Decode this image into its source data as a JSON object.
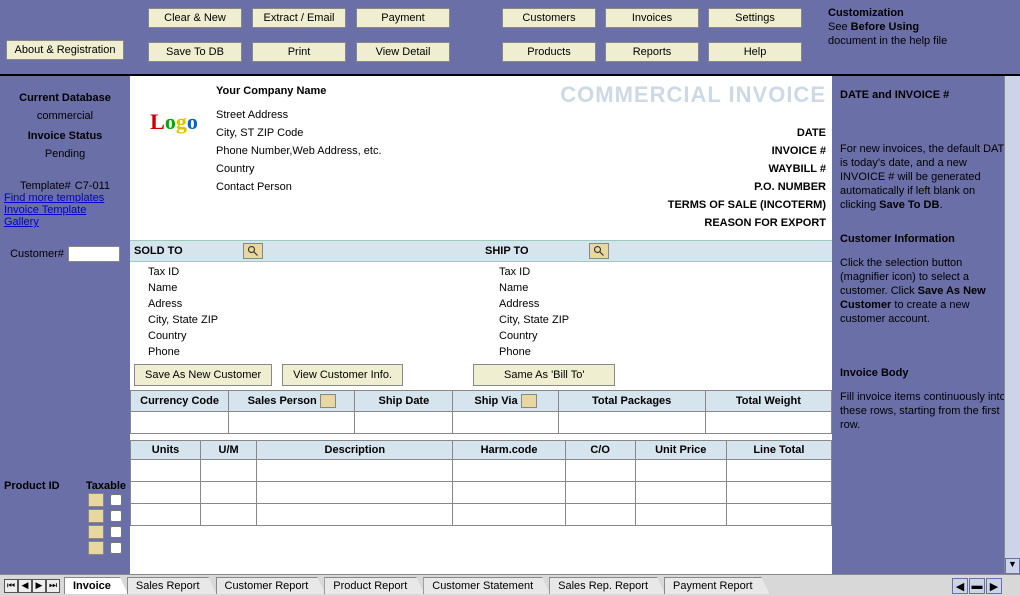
{
  "url": "www.office-kit.com",
  "buttons": {
    "about": "About & Registration",
    "clear_new": "Clear & New",
    "extract_email": "Extract / Email",
    "payment": "Payment",
    "customers": "Customers",
    "invoices": "Invoices",
    "settings": "Settings",
    "save_db": "Save To DB",
    "print": "Print",
    "view_detail": "View Detail",
    "products": "Products",
    "reports": "Reports",
    "help": "Help"
  },
  "top_help": {
    "title": "Customization",
    "l1": "See ",
    "b1": "Before Using",
    "l2": "document in the help file"
  },
  "left": {
    "db_hdr": "Current Database",
    "db_name": "commercial",
    "status_hdr": "Invoice Status",
    "status_val": "Pending",
    "template_lbl": "Template#",
    "template_val": "C7-011",
    "link1": "Find more templates",
    "link2": "Invoice Template ",
    "link3": "Gallery",
    "cust_lbl": "Customer#",
    "prod_hdr": "Product ID",
    "tax_hdr": "Taxable"
  },
  "center": {
    "company": {
      "name": "Your Company Name",
      "street": "Street Address",
      "city": "City, ST  ZIP Code",
      "phone": "Phone Number,Web Address, etc.",
      "country": "Country",
      "contact": "Contact Person"
    },
    "title": "COMMERCIAL INVOICE",
    "rlabels": [
      "DATE",
      "INVOICE #",
      "WAYBILL #",
      "P.O. NUMBER",
      "TERMS OF SALE (INCOTERM)",
      "REASON FOR EXPORT"
    ],
    "sold_to": "SOLD  TO",
    "ship_to": "SHIP TO",
    "addr_fields_sold": [
      "Tax ID",
      "Name",
      "Adress",
      "City, State ZIP",
      "Country",
      "Phone"
    ],
    "addr_fields_ship": [
      "Tax ID",
      "Name",
      "Address",
      "City, State ZIP",
      "Country",
      "Phone"
    ],
    "cust_btns": {
      "save_new": "Save As New Customer",
      "view_info": "View Customer Info.",
      "same_as": "Same As 'Bill To'"
    },
    "grid1": [
      "Currency Code",
      "Sales Person",
      "Ship Date",
      "Ship Via",
      "Total Packages",
      "Total Weight"
    ],
    "grid2": [
      "Units",
      "U/M",
      "Description",
      "Harm.code",
      "C/O",
      "Unit Price",
      "Line Total"
    ]
  },
  "right": {
    "h1": "DATE and INVOICE #",
    "p1a": "For new invoices, the default DATE is today's date, and a new INVOICE # will be generated automatically if left blank on clicking ",
    "p1b": "Save To DB",
    "h2": "Customer Information",
    "p2a": "Click the selection button (magnifier icon) to select a customer. Click ",
    "p2b": "Save As New Customer",
    "p2c": " to create a new customer account.",
    "h3": "Invoice Body",
    "p3": "Fill invoice items continuously into these rows, starting from the first row."
  },
  "tabs": [
    "Invoice",
    "Sales Report",
    "Customer Report",
    "Product Report",
    "Customer Statement",
    "Sales Rep. Report",
    "Payment Report"
  ]
}
